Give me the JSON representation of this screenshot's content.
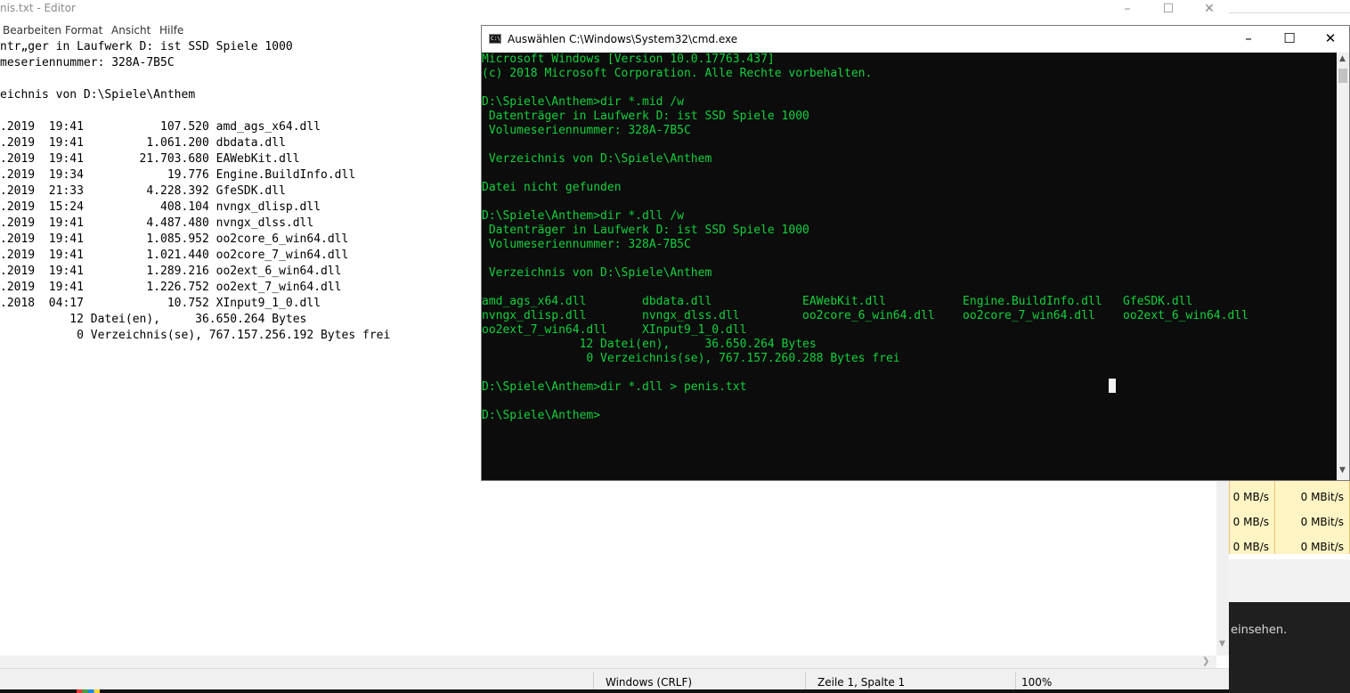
{
  "background_app": {
    "rows": [
      {
        "mbs": "0 MB/s",
        "mbits": "0 MBit/s"
      },
      {
        "mbs": "0 MB/s",
        "mbits": "0 MBit/s"
      },
      {
        "mbs": "0 MB/s",
        "mbits": "0 MBit/s"
      }
    ],
    "banner_text": "einsehen."
  },
  "notepad": {
    "title": "nis.txt - Editor",
    "menu": [
      "Bearbeiten",
      "Format",
      "Ansicht",
      "Hilfe"
    ],
    "lines": [
      "ntr„ger in Laufwerk D: ist SSD Spiele 1000",
      "meseriennummer: 328A-7B5C",
      "",
      "eichnis von D:\\Spiele\\Anthem",
      "",
      ".2019  19:41           107.520 amd_ags_x64.dll",
      ".2019  19:41         1.061.200 dbdata.dll",
      ".2019  19:41        21.703.680 EAWebKit.dll",
      ".2019  19:34            19.776 Engine.BuildInfo.dll",
      ".2019  21:33         4.228.392 GfeSDK.dll",
      ".2019  15:24           408.104 nvngx_dlisp.dll",
      ".2019  19:41         4.487.480 nvngx_dlss.dll",
      ".2019  19:41         1.085.952 oo2core_6_win64.dll",
      ".2019  19:41         1.021.440 oo2core_7_win64.dll",
      ".2019  19:41         1.289.216 oo2ext_6_win64.dll",
      ".2019  19:41         1.226.752 oo2ext_7_win64.dll",
      ".2018  04:17            10.752 XInput9_1_0.dll",
      "          12 Datei(en),     36.650.264 Bytes",
      "           0 Verzeichnis(se), 767.157.256.192 Bytes frei"
    ],
    "status": {
      "line_ending": "Windows (CRLF)",
      "position": "Zeile 1, Spalte 1",
      "zoom": "100%"
    }
  },
  "cmd": {
    "title": "Auswählen C:\\Windows\\System32\\cmd.exe",
    "lines": [
      "Microsoft Windows [Version 10.0.17763.437]",
      "(c) 2018 Microsoft Corporation. Alle Rechte vorbehalten.",
      "",
      "D:\\Spiele\\Anthem>dir *.mid /w",
      " Datenträger in Laufwerk D: ist SSD Spiele 1000",
      " Volumeseriennummer: 328A-7B5C",
      "",
      " Verzeichnis von D:\\Spiele\\Anthem",
      "",
      "Datei nicht gefunden",
      "",
      "D:\\Spiele\\Anthem>dir *.dll /w",
      " Datenträger in Laufwerk D: ist SSD Spiele 1000",
      " Volumeseriennummer: 328A-7B5C",
      "",
      " Verzeichnis von D:\\Spiele\\Anthem",
      "",
      "amd_ags_x64.dll        dbdata.dll             EAWebKit.dll           Engine.BuildInfo.dll   GfeSDK.dll",
      "nvngx_dlisp.dll        nvngx_dlss.dll         oo2core_6_win64.dll    oo2core_7_win64.dll    oo2ext_6_win64.dll",
      "oo2ext_7_win64.dll     XInput9_1_0.dll",
      "              12 Datei(en),     36.650.264 Bytes",
      "               0 Verzeichnis(se), 767.157.260.288 Bytes frei",
      "",
      "D:\\Spiele\\Anthem>dir *.dll > penis.txt",
      "",
      "D:\\Spiele\\Anthem>"
    ]
  }
}
